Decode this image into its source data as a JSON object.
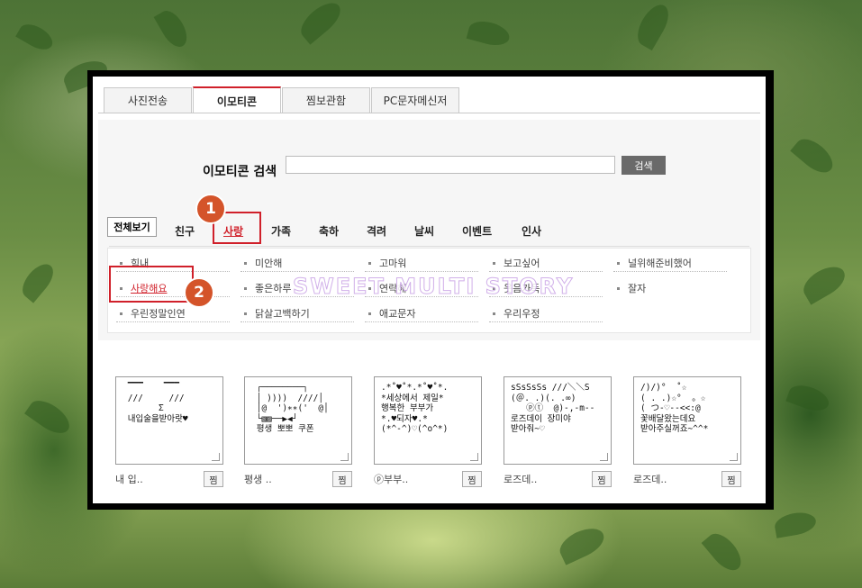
{
  "tabs": [
    {
      "label": "사진전송"
    },
    {
      "label": "이모티콘"
    },
    {
      "label": "찜보관함"
    },
    {
      "label": "PC문자메신저"
    }
  ],
  "search": {
    "label": "이모티콘 검색",
    "placeholder": "",
    "value": "",
    "button": "검색"
  },
  "categories": {
    "all": "전체보기",
    "items": [
      "친구",
      "사랑",
      "가족",
      "축하",
      "격려",
      "날씨",
      "이벤트",
      "인사"
    ]
  },
  "subcategories": [
    "힘내",
    "미안해",
    "고마워",
    "보고싶어",
    "널위해준비했어",
    "사랑해요",
    "좋은하루",
    "연락해",
    "웃음가득",
    "잘자",
    "우린정말인연",
    "닭살고백하기",
    "애교문자",
    "우리우정"
  ],
  "annotations": {
    "badge1": "1",
    "badge2": "2"
  },
  "watermark": "SWEET MULTI STORY",
  "emoticons": [
    {
      "art": " ▔▔▔    ▔▔▔\n ///     ///\n       Σ\n 내입술을받아랏♥",
      "caption": "내 입..",
      "fav": "찜"
    },
    {
      "art": " ┌────────┐\n │ ))))  ////│\n │@  ')∗∗('  @│\n └▧▨──▶◀┘\n 평생 뽀뽀 쿠폰",
      "caption": "평생 ..",
      "fav": "찜"
    },
    {
      "art": ".*˚♥˚*.*˚♥˚*.\n*세상에서 제일*\n행복한 부부가\n*.♥되자♥.*\n(*^-^)♡(^o^*)",
      "caption": "ⓟ부부..",
      "fav": "찜"
    },
    {
      "art": "sSsSsSs ///＼＼S\n(＠. .)(. .∞)\n   ⓟⓣ  @)-,-m--\n로즈데이 장미야\n받아줘~♡",
      "caption": "로즈데..",
      "fav": "찜"
    },
    {
      "art": "/)/)°  ˚☆\n( . .)☆°  。☆\n( つ-♡--<<:@\n꽃배달왔는데요\n받아주실꺼죠~^^*",
      "caption": "로즈데..",
      "fav": "찜"
    }
  ],
  "colors": {
    "accent": "#d0202a",
    "badge": "#d4542a"
  }
}
